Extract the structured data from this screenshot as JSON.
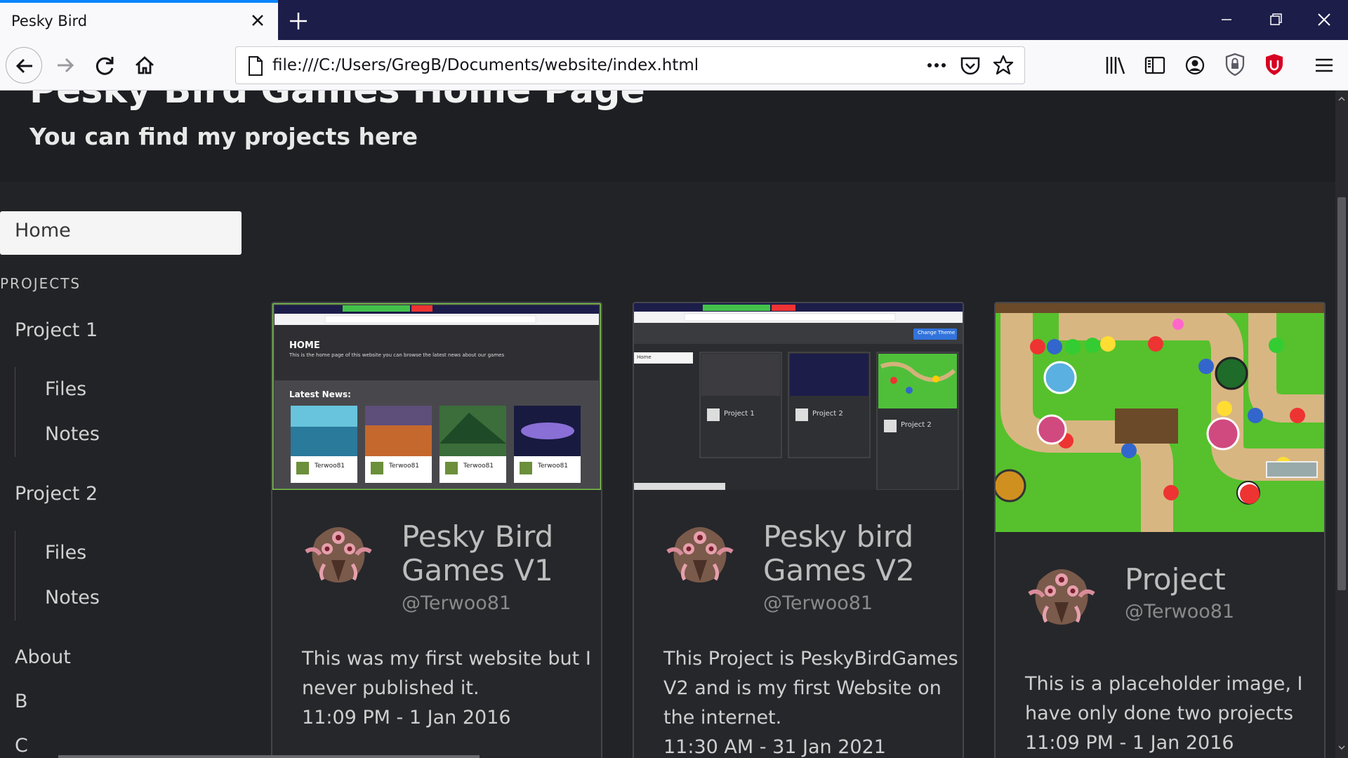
{
  "browser": {
    "tab_title": "Pesky Bird",
    "url": "file:///C:/Users/GregB/Documents/website/index.html",
    "accent": "#0a84ff"
  },
  "page": {
    "title": "Pesky Bird Games Home Page",
    "subtitle": "You can find my projects here"
  },
  "menu": {
    "home": "Home",
    "projects_label": "PROJECTS",
    "project1": "Project 1",
    "project1_files": "Files",
    "project1_notes": "Notes",
    "project2": "Project 2",
    "project2_files": "Files",
    "project2_notes": "Notes",
    "about": "About",
    "b": "B",
    "c": "C"
  },
  "cards": [
    {
      "title_line1": "Pesky Bird",
      "title_line2": "Games V1",
      "handle": "@Terwoo81",
      "text_line1": "This was my first website but I",
      "text_line2": "never published it.",
      "date": "11:09 PM - 1 Jan 2016",
      "image": "website-v1-screenshot",
      "thumb": {
        "heading": "HOME",
        "desc": "This is the home page of this website you can browse the latest news about our games",
        "news": "Latest News:",
        "author": "Terwoo81"
      }
    },
    {
      "title_line1": "Pesky bird",
      "title_line2": "Games V2",
      "handle": "@Terwoo81",
      "text_line1": "This Project is PeskyBirdGames",
      "text_line2": "V2 and is my first Website on",
      "text_line3": "the internet.",
      "date": "11:30 AM - 31 Jan 2021",
      "image": "website-v2-screenshot",
      "thumb": {
        "theme_button": "Change Theme",
        "home": "Home",
        "project1": "Project 1",
        "project2": "Project 2"
      }
    },
    {
      "title_line1": "Project",
      "handle": "@Terwoo81",
      "text_line1": "This is a placeholder image, I",
      "text_line2": "have only done two projects",
      "date": "11:09 PM - 1 Jan 2016",
      "image": "tower-defense-game-screenshot"
    }
  ]
}
